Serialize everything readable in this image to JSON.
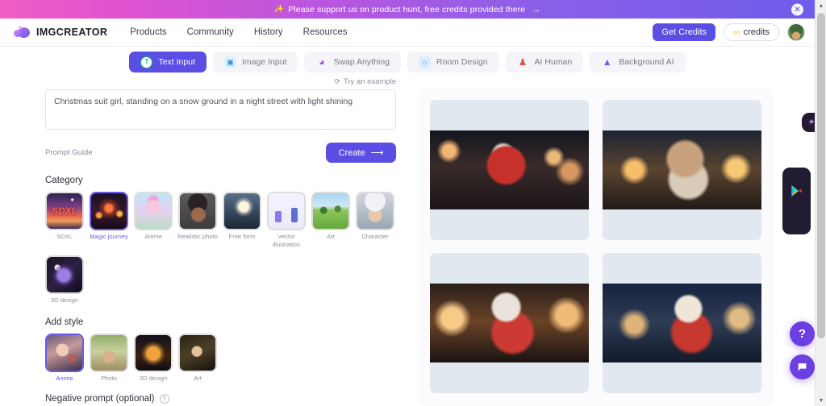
{
  "promo": {
    "sparkle_icon": "✨",
    "text": "Please support us on product hunt, free credits provided there",
    "arrow": "→",
    "close_icon": "✕",
    "background_colors": [
      "#ef5fc4",
      "#6f5cea"
    ]
  },
  "header": {
    "brand_name": "IMGCREATOR",
    "nav": [
      {
        "label": "Products"
      },
      {
        "label": "Community"
      },
      {
        "label": "History"
      },
      {
        "label": "Resources"
      }
    ],
    "get_credits_label": "Get Credits",
    "credits_label": "credits",
    "credits_icon": "∞",
    "accent_color": "#5b4ee5"
  },
  "tabs": [
    {
      "label": "Text Input",
      "icon": "text-input-icon",
      "glyph": "T",
      "active": true
    },
    {
      "label": "Image Input",
      "icon": "image-input-icon",
      "glyph": "🖼",
      "active": false
    },
    {
      "label": "Swap Anything",
      "icon": "swap-anything-icon",
      "glyph": "🎭",
      "active": false
    },
    {
      "label": "Room Design",
      "icon": "room-design-icon",
      "glyph": "🏠",
      "active": false
    },
    {
      "label": "AI Human",
      "icon": "ai-human-icon",
      "glyph": "🧑",
      "active": false
    },
    {
      "label": "Background AI",
      "icon": "background-ai-icon",
      "glyph": "🏔",
      "active": false
    }
  ],
  "prompt": {
    "try_example_label": "Try an example",
    "try_example_icon": "⟳",
    "value": "Christmas suit girl, standing on a snow ground in a night street with light shining",
    "placeholder": "Christmas suit girl, standing on a snow ground in a night street with light shining",
    "guide_label": "Prompt Guide",
    "create_label": "Create",
    "create_arrow": "⟶"
  },
  "category": {
    "title": "Category",
    "items": [
      {
        "label": "SDXL",
        "art": "art-sdxl",
        "selected": false
      },
      {
        "label": "Magic journey",
        "art": "art-magic",
        "selected": true
      },
      {
        "label": "Anime",
        "art": "art-anime",
        "selected": false
      },
      {
        "label": "Realistic photo",
        "art": "art-photo",
        "selected": false
      },
      {
        "label": "Free form",
        "art": "art-free",
        "selected": false
      },
      {
        "label": "Vector illustration",
        "art": "art-vector",
        "selected": false
      },
      {
        "label": "Art",
        "art": "art-art",
        "selected": false
      },
      {
        "label": "Character",
        "art": "art-char",
        "selected": false
      },
      {
        "label": "3D design",
        "art": "art-3d",
        "selected": false
      }
    ]
  },
  "style": {
    "title": "Add style",
    "items": [
      {
        "label": "Anime",
        "art": "art-s-anime",
        "selected": true
      },
      {
        "label": "Photo",
        "art": "art-s-photo",
        "selected": false
      },
      {
        "label": "3D design",
        "art": "art-s-3d",
        "selected": false
      },
      {
        "label": "Art",
        "art": "art-s-art",
        "selected": false
      }
    ]
  },
  "negative_prompt": {
    "title": "Negative prompt (optional)",
    "help_icon": "?"
  },
  "results": {
    "cards": [
      {
        "art": "img1",
        "alt": "anime girl in red hooded coat on snowy night street"
      },
      {
        "art": "img2",
        "alt": "anime girl in beige coat with red scarf, night lights"
      },
      {
        "art": "img3",
        "alt": "anime girl in santa hat and red coat, warm street lights"
      },
      {
        "art": "img4",
        "alt": "anime girl in santa hat on blue snowy night street"
      }
    ]
  },
  "widgets": {
    "sparkle_tab_icon": "✦",
    "store_pill": {
      "play_icon": "google-play-icon",
      "apple_icon": ""
    },
    "help_fab": "?",
    "chat_fab": "▭"
  }
}
